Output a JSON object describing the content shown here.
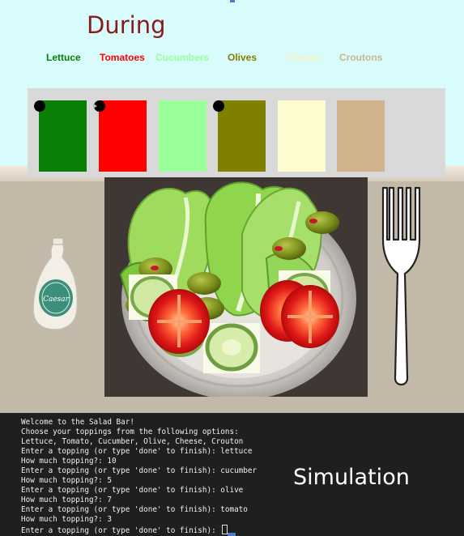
{
  "scene": {
    "title": "During",
    "toppings": [
      {
        "label": "Lettuce",
        "color": "#0a7e07",
        "marker": "dot"
      },
      {
        "label": "Tomatoes",
        "color": "#ff0000",
        "marker": "dot-play"
      },
      {
        "label": "Cucumbers",
        "color": "#99ff99",
        "marker": "none"
      },
      {
        "label": "Olives",
        "color": "#808000",
        "marker": "dot"
      },
      {
        "label": "Cheese",
        "color": "#fffdd0",
        "marker": "none"
      },
      {
        "label": "Croutons",
        "color": "#d2b48c",
        "marker": "none"
      }
    ],
    "label_colors": [
      "#0a7e07",
      "#ff0000",
      "#99ff99",
      "#808000",
      "#f4f4c0",
      "#d2b48c"
    ],
    "bottle_text": "Caesar"
  },
  "terminal": {
    "lines": [
      "Welcome to the Salad Bar!",
      "Choose your toppings from the following options:",
      "Lettuce, Tomato, Cucumber, Olive, Cheese, Crouton",
      "Enter a topping (or type 'done' to finish): lettuce",
      "How much topping?: 10",
      "Enter a topping (or type 'done' to finish): cucumber",
      "How much topping?: 5",
      "Enter a topping (or type 'done' to finish): olive",
      "How much topping?: 7",
      "Enter a topping (or type 'done' to finish): tomato",
      "How much topping?: 3",
      "Enter a topping (or type 'done' to finish): "
    ],
    "caption": "Simulation"
  }
}
